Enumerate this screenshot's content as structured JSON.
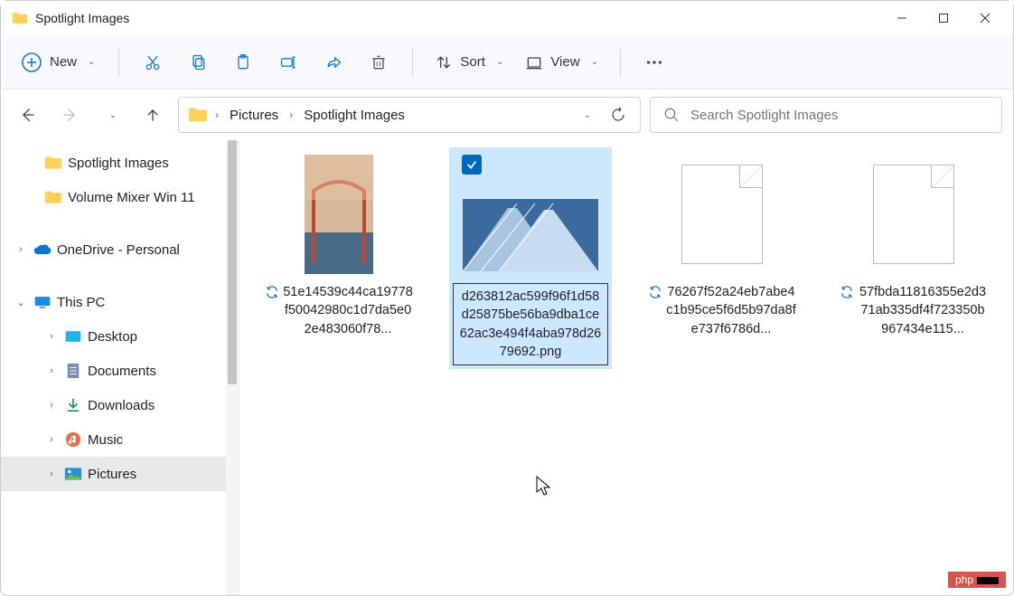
{
  "window": {
    "title": "Spotlight Images"
  },
  "toolbar": {
    "new_label": "New",
    "sort_label": "Sort",
    "view_label": "View"
  },
  "breadcrumb": {
    "root": "Pictures",
    "current": "Spotlight Images"
  },
  "search": {
    "placeholder": "Search Spotlight Images"
  },
  "sidebar": {
    "quick": [
      {
        "label": "Spotlight Images"
      },
      {
        "label": "Volume Mixer Win 11"
      }
    ],
    "onedrive": {
      "label": "OneDrive - Personal"
    },
    "thispc": {
      "label": "This PC",
      "children": [
        {
          "label": "Desktop"
        },
        {
          "label": "Documents"
        },
        {
          "label": "Downloads"
        },
        {
          "label": "Music"
        },
        {
          "label": "Pictures"
        }
      ]
    }
  },
  "files": [
    {
      "name": "51e14539c44ca19778f50042980c1d7da5e02e483060f78...",
      "sync": true,
      "kind": "image-portrait",
      "selected": false
    },
    {
      "name": "d263812ac599f96f1d58d25875be56ba9dba1ce62ac3e494f4aba978d2679692.png",
      "sync": false,
      "kind": "image-landscape",
      "selected": true,
      "editing": true
    },
    {
      "name": "76267f52a24eb7abe4c1b95ce5f6d5b97da8fe737f6786d...",
      "sync": true,
      "kind": "blank",
      "selected": false
    },
    {
      "name": "57fbda11816355e2d371ab335df4f723350b967434e115...",
      "sync": true,
      "kind": "blank",
      "selected": false
    }
  ],
  "watermark": "php"
}
